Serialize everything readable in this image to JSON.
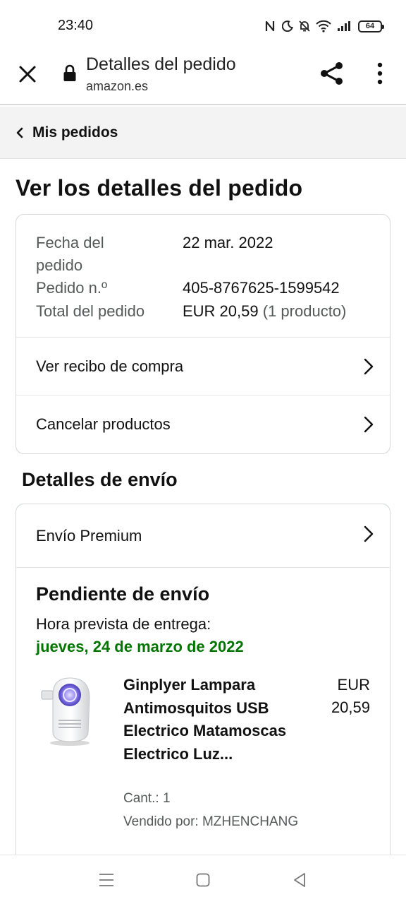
{
  "status_bar": {
    "time": "23:40",
    "battery_level": "64",
    "icons": [
      "nfc-icon",
      "moon-icon",
      "bell-off-icon",
      "wifi-icon",
      "signal-icon",
      "battery-icon"
    ]
  },
  "browser": {
    "title": "Detalles del pedido",
    "domain": "amazon.es"
  },
  "breadcrumb": {
    "label": "Mis pedidos"
  },
  "main": {
    "title": "Ver los detalles del pedido"
  },
  "order_summary": {
    "date_label_line1": "Fecha del",
    "date_label_line2": "pedido",
    "date_value": "22 mar. 2022",
    "number_label": "Pedido n.º",
    "number_value": "405-8767625-1599542",
    "total_label": "Total del pedido",
    "total_value": "EUR 20,59",
    "total_count": "(1 producto)"
  },
  "actions": {
    "receipt": "Ver recibo de compra",
    "cancel": "Cancelar productos"
  },
  "shipping": {
    "section_title": "Detalles de envío",
    "method": "Envío Premium",
    "status": "Pendiente de envío",
    "eta_label": "Hora prevista de entrega:",
    "eta_date": "jueves, 24 de marzo de 2022"
  },
  "product": {
    "title": "Ginplyer Lampara Antimosquitos USB Electrico Matamoscas Electrico Luz...",
    "price_currency": "EUR",
    "price_amount": "20,59",
    "quantity": "Cant.: 1",
    "seller": "Vendido por: MZHENCHANG"
  },
  "colors": {
    "eta_green": "#007600",
    "muted_text": "#565959",
    "border": "#d5d9d9",
    "breadcrumb_bg": "#f3f3f3"
  }
}
